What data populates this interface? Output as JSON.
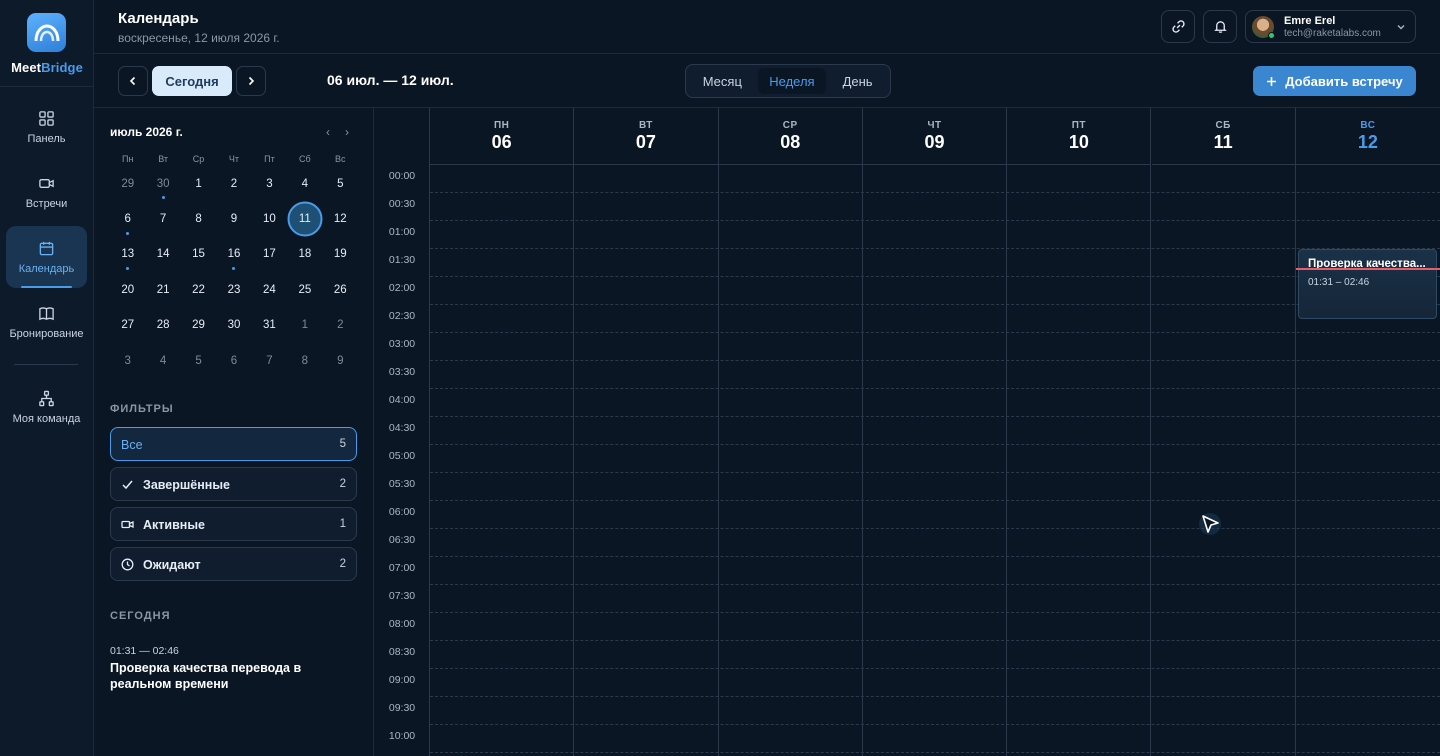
{
  "brand": {
    "name_a": "Meet",
    "name_b": "Bridge"
  },
  "nav": {
    "items": [
      {
        "label": "Панель",
        "icon": "grid-icon"
      },
      {
        "label": "Встречи",
        "icon": "video-icon"
      },
      {
        "label": "Календарь",
        "icon": "calendar-icon"
      },
      {
        "label": "Бронирование",
        "icon": "book-icon"
      },
      {
        "label": "Моя команда",
        "icon": "team-icon"
      }
    ],
    "active": "Календарь"
  },
  "header": {
    "title": "Календарь",
    "date": "воскресенье, 12 июля 2026 г.",
    "user_name": "Emre Erel",
    "user_email": "tech@raketalabs.com"
  },
  "toolbar": {
    "today": "Сегодня",
    "range": "06 июл. — 12 июл.",
    "views": [
      "Месяц",
      "Неделя",
      "День"
    ],
    "active_view": "Неделя",
    "add_label": "Добавить встречу"
  },
  "mini_calendar": {
    "title": "июль 2026 г.",
    "weekdays": [
      "Пн",
      "Вт",
      "Ср",
      "Чт",
      "Пт",
      "Сб",
      "Вс"
    ],
    "weeks": [
      [
        "29",
        "30",
        "1",
        "2",
        "3",
        "4",
        "5"
      ],
      [
        "6",
        "7",
        "8",
        "9",
        "10",
        "11",
        "12"
      ],
      [
        "13",
        "14",
        "15",
        "16",
        "17",
        "18",
        "19"
      ],
      [
        "20",
        "21",
        "22",
        "23",
        "24",
        "25",
        "26"
      ],
      [
        "27",
        "28",
        "29",
        "30",
        "31",
        "1",
        "2"
      ],
      [
        "3",
        "4",
        "5",
        "6",
        "7",
        "8",
        "9"
      ]
    ],
    "selected": "11"
  },
  "filters": {
    "label": "ФИЛЬТРЫ",
    "items": [
      {
        "label": "Все",
        "count": "5"
      },
      {
        "label": "Завершённые",
        "count": "2"
      },
      {
        "label": "Активные",
        "count": "1"
      },
      {
        "label": "Ожидают",
        "count": "2"
      }
    ]
  },
  "today_section": {
    "label": "СЕГОДНЯ",
    "time": "01:31 — 02:46",
    "title": "Проверка качества перевода в реальном времени"
  },
  "week": {
    "days": [
      {
        "short": "ПН",
        "num": "06"
      },
      {
        "short": "ВТ",
        "num": "07"
      },
      {
        "short": "СР",
        "num": "08"
      },
      {
        "short": "ЧТ",
        "num": "09"
      },
      {
        "short": "ПТ",
        "num": "10"
      },
      {
        "short": "СБ",
        "num": "11"
      },
      {
        "short": "ВС",
        "num": "12"
      }
    ],
    "times": [
      "00:00",
      "00:30",
      "01:00",
      "01:30",
      "02:00",
      "02:30",
      "03:00",
      "03:30",
      "04:00",
      "04:30",
      "05:00",
      "05:30",
      "06:00",
      "06:30",
      "07:00",
      "07:30",
      "08:00",
      "08:30",
      "09:00",
      "09:30",
      "10:00"
    ]
  },
  "event": {
    "title": "Проверка качества...",
    "time": "01:31 – 02:46"
  },
  "colors": {
    "accent": "#4a9be9",
    "background": "#0b1624",
    "now_line": "#e35d6a"
  }
}
